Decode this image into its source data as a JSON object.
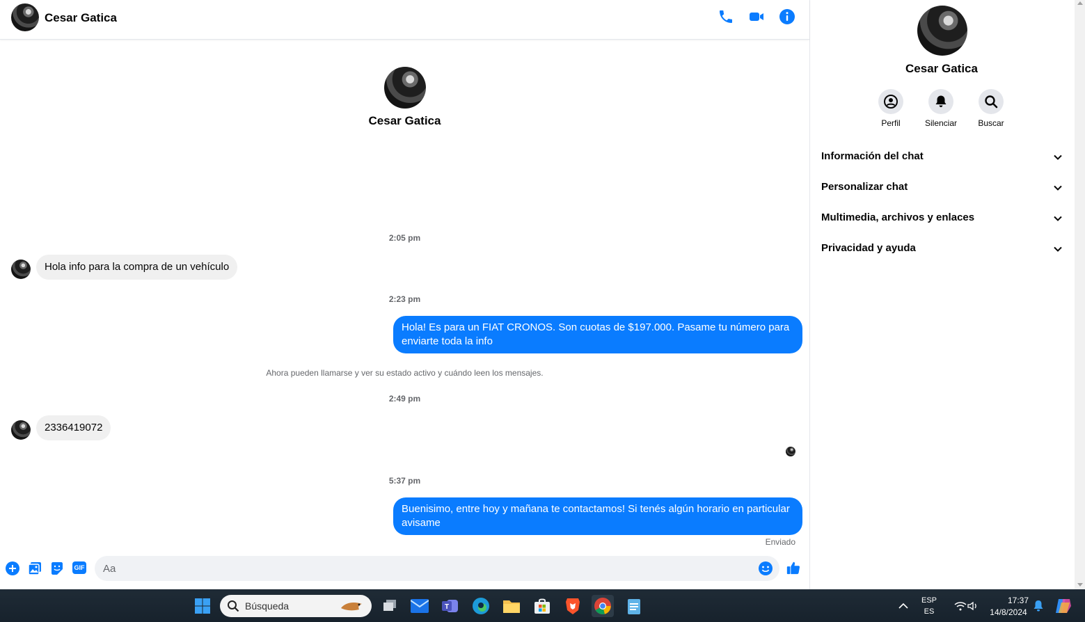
{
  "header": {
    "contact_name": "Cesar Gatica"
  },
  "intro": {
    "contact_name": "Cesar Gatica"
  },
  "messages": {
    "ts1": "2:05 pm",
    "in1": "Hola info para la compra de un vehículo",
    "ts2": "2:23 pm",
    "out1": "Hola! Es para un FIAT CRONOS. Son cuotas de $197.000. Pasame tu número para enviarte toda la info",
    "system": "Ahora pueden llamarse y ver su estado activo y cuándo leen los mensajes.",
    "ts3": "2:49 pm",
    "in2": "2336419072",
    "ts4": "5:37 pm",
    "out2": "Buenisimo, entre hoy y mañana te contactamos! Si tenés algún horario en particular avisame",
    "status": "Enviado"
  },
  "composer": {
    "placeholder": "Aa",
    "gif_label": "GIF"
  },
  "info_panel": {
    "contact_name": "Cesar Gatica",
    "actions": [
      {
        "label": "Perfil",
        "icon": "profile-icon"
      },
      {
        "label": "Silenciar",
        "icon": "bell-icon"
      },
      {
        "label": "Buscar",
        "icon": "search-icon"
      }
    ],
    "sections": [
      {
        "label": "Información del chat"
      },
      {
        "label": "Personalizar chat"
      },
      {
        "label": "Multimedia, archivos y enlaces"
      },
      {
        "label": "Privacidad y ayuda"
      }
    ]
  },
  "taskbar": {
    "search_placeholder": "Búsqueda",
    "lang_top": "ESP",
    "lang_bottom": "ES",
    "time": "17:37",
    "date": "14/8/2024"
  },
  "colors": {
    "accent": "#0a7cff",
    "incoming_bubble": "#f0f0f0",
    "secondary_text": "#65676b"
  }
}
